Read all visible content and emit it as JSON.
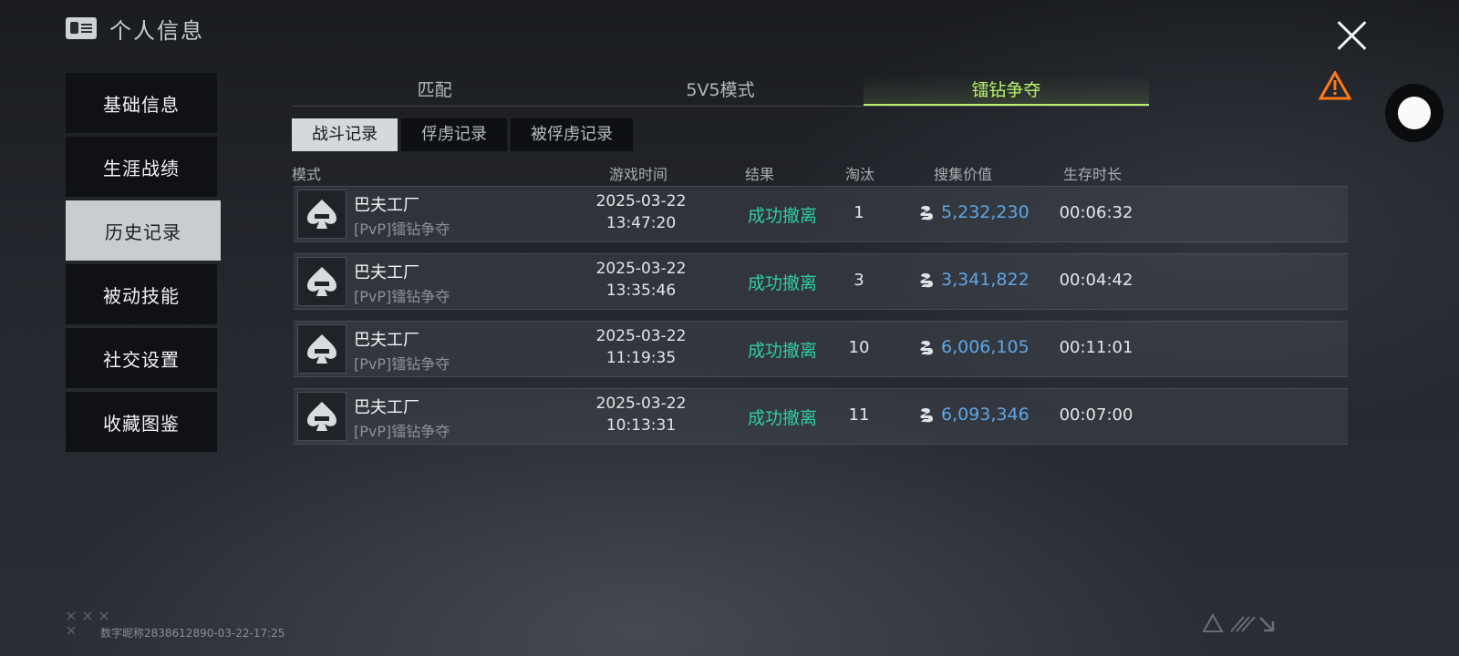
{
  "header": {
    "title": "个人信息",
    "icon": "id-card-icon"
  },
  "sidebar": {
    "items": [
      {
        "label": "基础信息"
      },
      {
        "label": "生涯战绩"
      },
      {
        "label": "历史记录",
        "active": true
      },
      {
        "label": "被动技能"
      },
      {
        "label": "社交设置"
      },
      {
        "label": "收藏图鉴"
      }
    ]
  },
  "tabs": [
    {
      "label": "匹配"
    },
    {
      "label": "5V5模式"
    },
    {
      "label": "镭钻争夺",
      "active": true
    }
  ],
  "subtabs": [
    {
      "label": "战斗记录",
      "active": true
    },
    {
      "label": "俘虏记录"
    },
    {
      "label": "被俘虏记录"
    }
  ],
  "table": {
    "headers": {
      "mode": "模式",
      "time": "游戏时间",
      "result": "结果",
      "kills": "淘汰",
      "value": "搜集价值",
      "duration": "生存时长"
    },
    "rows": [
      {
        "map": "巴夫工厂",
        "mode": "[PvP]镭钻争夺",
        "date": "2025-03-22",
        "time": "13:47:20",
        "result": "成功撤离",
        "kills": "1",
        "value": "5,232,230",
        "duration": "00:06:32"
      },
      {
        "map": "巴夫工厂",
        "mode": "[PvP]镭钻争夺",
        "date": "2025-03-22",
        "time": "13:35:46",
        "result": "成功撤离",
        "kills": "3",
        "value": "3,341,822",
        "duration": "00:04:42"
      },
      {
        "map": "巴夫工厂",
        "mode": "[PvP]镭钻争夺",
        "date": "2025-03-22",
        "time": "11:19:35",
        "result": "成功撤离",
        "kills": "10",
        "value": "6,006,105",
        "duration": "00:11:01"
      },
      {
        "map": "巴夫工厂",
        "mode": "[PvP]镭钻争夺",
        "date": "2025-03-22",
        "time": "10:13:31",
        "result": "成功撤离",
        "kills": "11",
        "value": "6,093,346",
        "duration": "00:07:00"
      }
    ]
  },
  "footer": {
    "watermark": "数字昵称2838612890-03-22-17:25"
  },
  "colors": {
    "accent": "#b8f26a",
    "success": "#2fcf9e",
    "value": "#5ea6e6",
    "warning": "#ff7a1a"
  }
}
